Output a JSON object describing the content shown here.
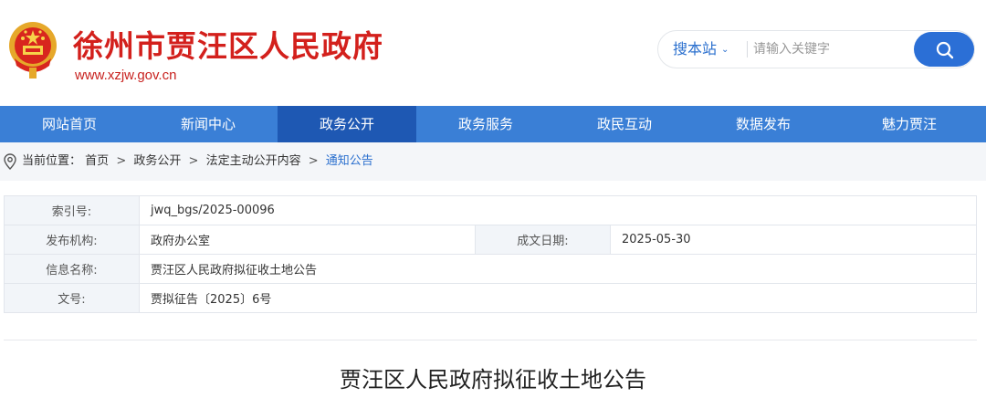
{
  "header": {
    "site_title": "徐州市贾汪区人民政府",
    "site_url": "www.xzjw.gov.cn",
    "emblem_icon": "national-emblem-icon",
    "brand_color": "#d3201c"
  },
  "search": {
    "scope_label": "搜本站",
    "placeholder": "请输入关键字",
    "button_icon": "search-icon",
    "accent": "#2b6fd6"
  },
  "nav": {
    "items": [
      {
        "label": "网站首页"
      },
      {
        "label": "新闻中心"
      },
      {
        "label": "政务公开"
      },
      {
        "label": "政务服务"
      },
      {
        "label": "政民互动"
      },
      {
        "label": "数据发布"
      },
      {
        "label": "魅力贾汪"
      }
    ],
    "active_index": 2,
    "bg_color": "#3a7fd6",
    "active_color": "#1e58b3"
  },
  "breadcrumb": {
    "prefix": "当前位置：",
    "items": [
      "首页",
      "政务公开",
      "法定主动公开内容",
      "通知公告"
    ],
    "separator": ">"
  },
  "info": {
    "index_label": "索引号:",
    "index_value": "jwq_bgs/2025-00096",
    "org_label": "发布机构:",
    "org_value": "政府办公室",
    "date_label": "成文日期:",
    "date_value": "2025-05-30",
    "name_label": "信息名称:",
    "name_value": "贾汪区人民政府拟征收土地公告",
    "docno_label": "文号:",
    "docno_value": "贾拟征告〔2025〕6号"
  },
  "document": {
    "title": "贾汪区人民政府拟征收土地公告"
  }
}
